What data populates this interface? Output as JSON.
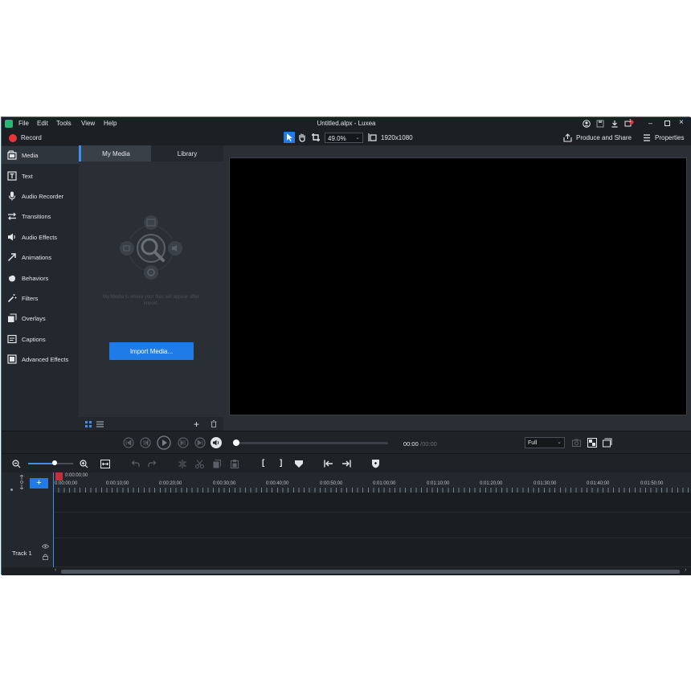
{
  "window": {
    "title": "Untitled.alpx - Luxea",
    "menu": [
      "File",
      "Edit",
      "Tools",
      "View",
      "Help"
    ],
    "notification_count": "1"
  },
  "toolbar": {
    "record_label": "Record",
    "zoom_value": "49.0%",
    "resolution": "1920x1080",
    "produce_label": "Produce and Share",
    "properties_label": "Properties"
  },
  "sidebar": {
    "items": [
      {
        "label": "Media",
        "icon": "media-icon",
        "active": true
      },
      {
        "label": "Text",
        "icon": "text-icon"
      },
      {
        "label": "Audio Recorder",
        "icon": "microphone-icon"
      },
      {
        "label": "Transitions",
        "icon": "transitions-icon"
      },
      {
        "label": "Audio Effects",
        "icon": "speaker-icon"
      },
      {
        "label": "Animations",
        "icon": "arrow-icon"
      },
      {
        "label": "Behaviors",
        "icon": "behaviors-icon"
      },
      {
        "label": "Filters",
        "icon": "magic-wand-icon"
      },
      {
        "label": "Overlays",
        "icon": "overlays-icon"
      },
      {
        "label": "Captions",
        "icon": "captions-icon"
      },
      {
        "label": "Advanced Effects",
        "icon": "effects-icon"
      }
    ]
  },
  "media_panel": {
    "tabs": [
      "My Media",
      "Library"
    ],
    "hint": "My Media is where your files will appear after import.",
    "import_label": "Import Media..."
  },
  "playback": {
    "time": "00:00",
    "duration": "/00:00",
    "view_mode": "Full"
  },
  "timeline": {
    "playhead_time": "0:00:00;00",
    "ruler_labels": [
      "0:00:00;00",
      "0:00:10;00",
      "0:00:20;00",
      "0:00:30;00",
      "0:00:40;00",
      "0:00:50;00",
      "0:01:00;00",
      "0:01:10;00",
      "0:01:20;00",
      "0:01:30;00",
      "0:01:40;00",
      "0:01:50;00"
    ],
    "track_name": "Track 1"
  },
  "colors": {
    "accent": "#1e7be8",
    "record": "#e8343a",
    "background": "#1f2328"
  }
}
